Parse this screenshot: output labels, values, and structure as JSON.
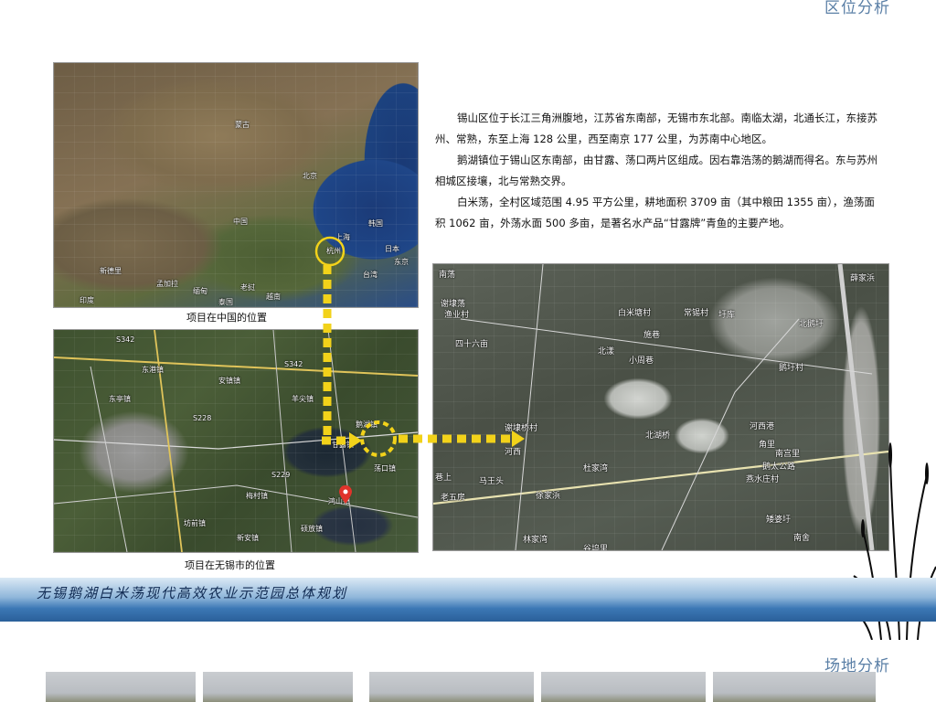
{
  "headers": {
    "location_analysis": "区位分析",
    "site_analysis": "场地分析"
  },
  "captions": {
    "china": "项目在中国的位置",
    "wuxi": "项目在无锡市的位置"
  },
  "description": [
    "锡山区位于长江三角洲腹地，江苏省东南部，无锡市东北部。南临太湖，北通长江，东接苏州、常熟，东至上海 128 公里，西至南京 177 公里，为苏南中心地区。",
    "鹅湖镇位于锡山区东南部，由甘露、荡口两片区组成。因右靠浩荡的鹅湖而得名。东与苏州相城区接壤，北与常熟交界。",
    "白米荡，全村区域范围 4.95 平方公里，耕地面积 3709 亩（其中粮田 1355 亩），渔荡面积 1062 亩，外荡水面 500 多亩，是著名水产品“甘露牌”青鱼的主要产地。"
  ],
  "banner_title": "无锡鹅湖白米荡现代高效农业示范园总体规划",
  "china_map_labels": [
    "蒙古",
    "中国",
    "印度",
    "日本",
    "韩国",
    "北京",
    "上海",
    "新德里",
    "孟加拉",
    "缅甸",
    "泰国",
    "东京",
    "台湾",
    "越南",
    "老挝",
    "杭州"
  ],
  "wuxi_map_labels": [
    "S342",
    "S342",
    "S228",
    "S229",
    "安镇镇",
    "东港镇",
    "羊尖镇",
    "鹅湖镇",
    "荡口镇",
    "甘露镇",
    "鸿山镇",
    "梅村镇",
    "坊前镇",
    "新安镇",
    "硕放镇",
    "东亭镇"
  ],
  "site_map_labels": [
    "南荡",
    "谢埭荡",
    "渔业村",
    "白米塘村",
    "常锡村",
    "圩库",
    "薛家浜",
    "北鹅圩",
    "四十六亩",
    "施巷",
    "北漾",
    "小周巷",
    "鹅圩村",
    "谢埭桥村",
    "河西",
    "北湖桥",
    "河西港",
    "角里",
    "鹅太公路",
    "南宫里",
    "燕水庄村",
    "杜家湾",
    "巷上",
    "马王头",
    "老五房",
    "徐家浜",
    "矮婆圩",
    "南舍",
    "林家湾",
    "谷坞里"
  ],
  "colors": {
    "arrow": "#f2d21a",
    "section_title": "#5a7fa6",
    "banner_dark": "#2a5f99",
    "banner_text": "#102a52"
  }
}
